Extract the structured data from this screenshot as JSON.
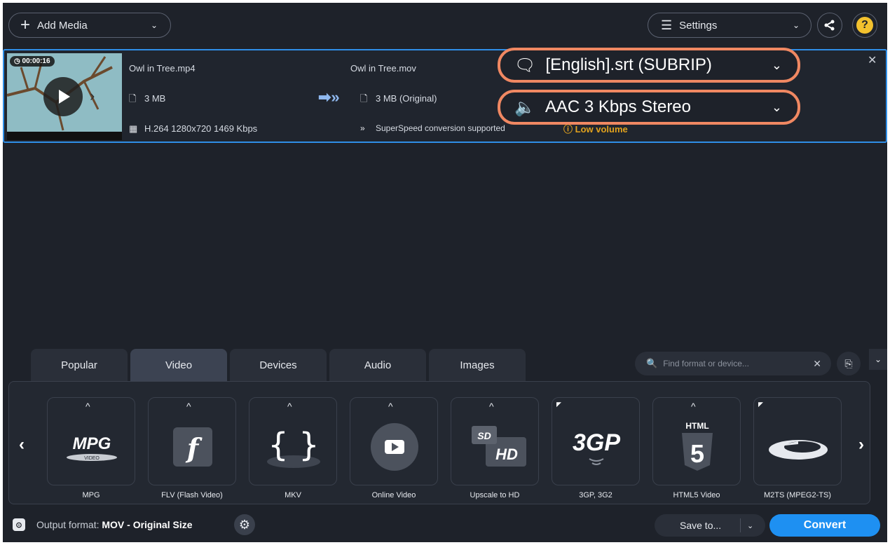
{
  "toolbar": {
    "add_media_label": "Add Media",
    "settings_label": "Settings"
  },
  "file": {
    "duration": "00:00:16",
    "source_name": "Owl in Tree.mp4",
    "source_size": "3 MB",
    "source_codec": "H.264 1280x720 1469 Kbps",
    "output_name": "Owl in Tree.mov",
    "output_size": "3 MB (Original)",
    "superspeed": "SuperSpeed conversion supported",
    "subtitle_track": "[English].srt (SUBRIP)",
    "audio_track": "AAC 3 Kbps Stereo",
    "warning": "Low volume"
  },
  "tabs": [
    {
      "label": "Popular"
    },
    {
      "label": "Video"
    },
    {
      "label": "Devices"
    },
    {
      "label": "Audio"
    },
    {
      "label": "Images"
    }
  ],
  "active_tab": "Video",
  "search": {
    "placeholder": "Find format or device..."
  },
  "formats": [
    {
      "label": "MPG",
      "art": "MPG"
    },
    {
      "label": "FLV (Flash Video)",
      "art": "f"
    },
    {
      "label": "MKV",
      "art": "{ }"
    },
    {
      "label": "Online Video",
      "art": "play"
    },
    {
      "label": "Upscale to HD",
      "art": "SD HD"
    },
    {
      "label": "3GP, 3G2",
      "art": "3GP"
    },
    {
      "label": "HTML5 Video",
      "art": "HTML 5"
    },
    {
      "label": "M2TS (MPEG2-TS)",
      "art": "bluray"
    }
  ],
  "footer": {
    "output_label": "Output format:",
    "output_value": "MOV - Original Size",
    "save_to": "Save to...",
    "convert": "Convert"
  },
  "colors": {
    "accent": "#1e90f2",
    "highlight_ring": "#f08862",
    "warning": "#e2a21d",
    "selection": "#2f8fe8"
  }
}
